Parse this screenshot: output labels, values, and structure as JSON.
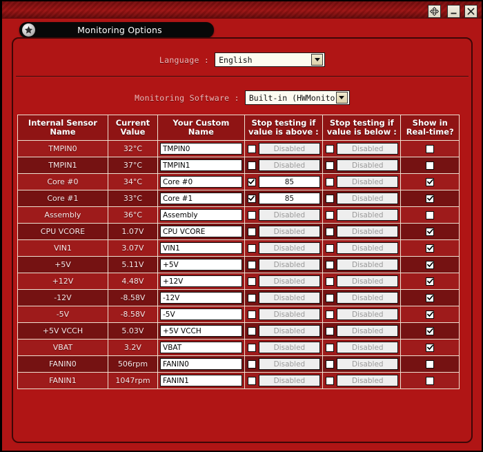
{
  "window": {
    "title_bar_buttons": [
      {
        "name": "move-resize-button",
        "icon": "move-arrows-icon"
      },
      {
        "name": "minimize-button",
        "icon": "minimize-icon"
      },
      {
        "name": "close-button",
        "icon": "close-icon"
      }
    ]
  },
  "tab": {
    "label": "Monitoring Options",
    "icon": "star-icon"
  },
  "form": {
    "language": {
      "label": "Language :",
      "value": "English"
    },
    "monitoring_software": {
      "label": "Monitoring Software :",
      "value": "Built-in (HWMonitor)"
    }
  },
  "table": {
    "headers": [
      "Internal Sensor Name",
      "Current Value",
      "Your Custom Name",
      "Stop testing if value is above :",
      "Stop testing if value is below :",
      "Show in Real-time?"
    ],
    "disabled_placeholder": "Disabled",
    "rows": [
      {
        "sensor": "TMPIN0",
        "value": "32°C",
        "custom": "TMPIN0",
        "above_checked": false,
        "above_value": "Disabled",
        "below_checked": false,
        "below_value": "Disabled",
        "realtime": false
      },
      {
        "sensor": "TMPIN1",
        "value": "37°C",
        "custom": "TMPIN1",
        "above_checked": false,
        "above_value": "Disabled",
        "below_checked": false,
        "below_value": "Disabled",
        "realtime": false
      },
      {
        "sensor": "Core #0",
        "value": "34°C",
        "custom": "Core #0",
        "above_checked": true,
        "above_value": "85",
        "below_checked": false,
        "below_value": "Disabled",
        "realtime": true
      },
      {
        "sensor": "Core #1",
        "value": "33°C",
        "custom": "Core #1",
        "above_checked": true,
        "above_value": "85",
        "below_checked": false,
        "below_value": "Disabled",
        "realtime": true
      },
      {
        "sensor": "Assembly",
        "value": "36°C",
        "custom": "Assembly",
        "above_checked": false,
        "above_value": "Disabled",
        "below_checked": false,
        "below_value": "Disabled",
        "realtime": false
      },
      {
        "sensor": "CPU VCORE",
        "value": "1.07V",
        "custom": "CPU VCORE",
        "above_checked": false,
        "above_value": "Disabled",
        "below_checked": false,
        "below_value": "Disabled",
        "realtime": true
      },
      {
        "sensor": "VIN1",
        "value": "3.07V",
        "custom": "VIN1",
        "above_checked": false,
        "above_value": "Disabled",
        "below_checked": false,
        "below_value": "Disabled",
        "realtime": true
      },
      {
        "sensor": "+5V",
        "value": "5.11V",
        "custom": "+5V",
        "above_checked": false,
        "above_value": "Disabled",
        "below_checked": false,
        "below_value": "Disabled",
        "realtime": true
      },
      {
        "sensor": "+12V",
        "value": "4.48V",
        "custom": "+12V",
        "above_checked": false,
        "above_value": "Disabled",
        "below_checked": false,
        "below_value": "Disabled",
        "realtime": true
      },
      {
        "sensor": "-12V",
        "value": "-8.58V",
        "custom": "-12V",
        "above_checked": false,
        "above_value": "Disabled",
        "below_checked": false,
        "below_value": "Disabled",
        "realtime": true
      },
      {
        "sensor": "-5V",
        "value": "-8.58V",
        "custom": "-5V",
        "above_checked": false,
        "above_value": "Disabled",
        "below_checked": false,
        "below_value": "Disabled",
        "realtime": true
      },
      {
        "sensor": "+5V VCCH",
        "value": "5.03V",
        "custom": "+5V VCCH",
        "above_checked": false,
        "above_value": "Disabled",
        "below_checked": false,
        "below_value": "Disabled",
        "realtime": true
      },
      {
        "sensor": "VBAT",
        "value": "3.2V",
        "custom": "VBAT",
        "above_checked": false,
        "above_value": "Disabled",
        "below_checked": false,
        "below_value": "Disabled",
        "realtime": true
      },
      {
        "sensor": "FANIN0",
        "value": "506rpm",
        "custom": "FANIN0",
        "above_checked": false,
        "above_value": "Disabled",
        "below_checked": false,
        "below_value": "Disabled",
        "realtime": false
      },
      {
        "sensor": "FANIN1",
        "value": "1047rpm",
        "custom": "FANIN1",
        "above_checked": false,
        "above_value": "Disabled",
        "below_checked": false,
        "below_value": "Disabled",
        "realtime": false
      }
    ]
  },
  "colors": {
    "background": "#b01515",
    "titlebar": "#a01818",
    "header_cell": "#8f1414",
    "row_odd": "#9e1b1b",
    "row_even": "#751212",
    "grid_line": "#f0e2d2",
    "label_text": "#f2b9b9",
    "tab_background": "#080808"
  }
}
